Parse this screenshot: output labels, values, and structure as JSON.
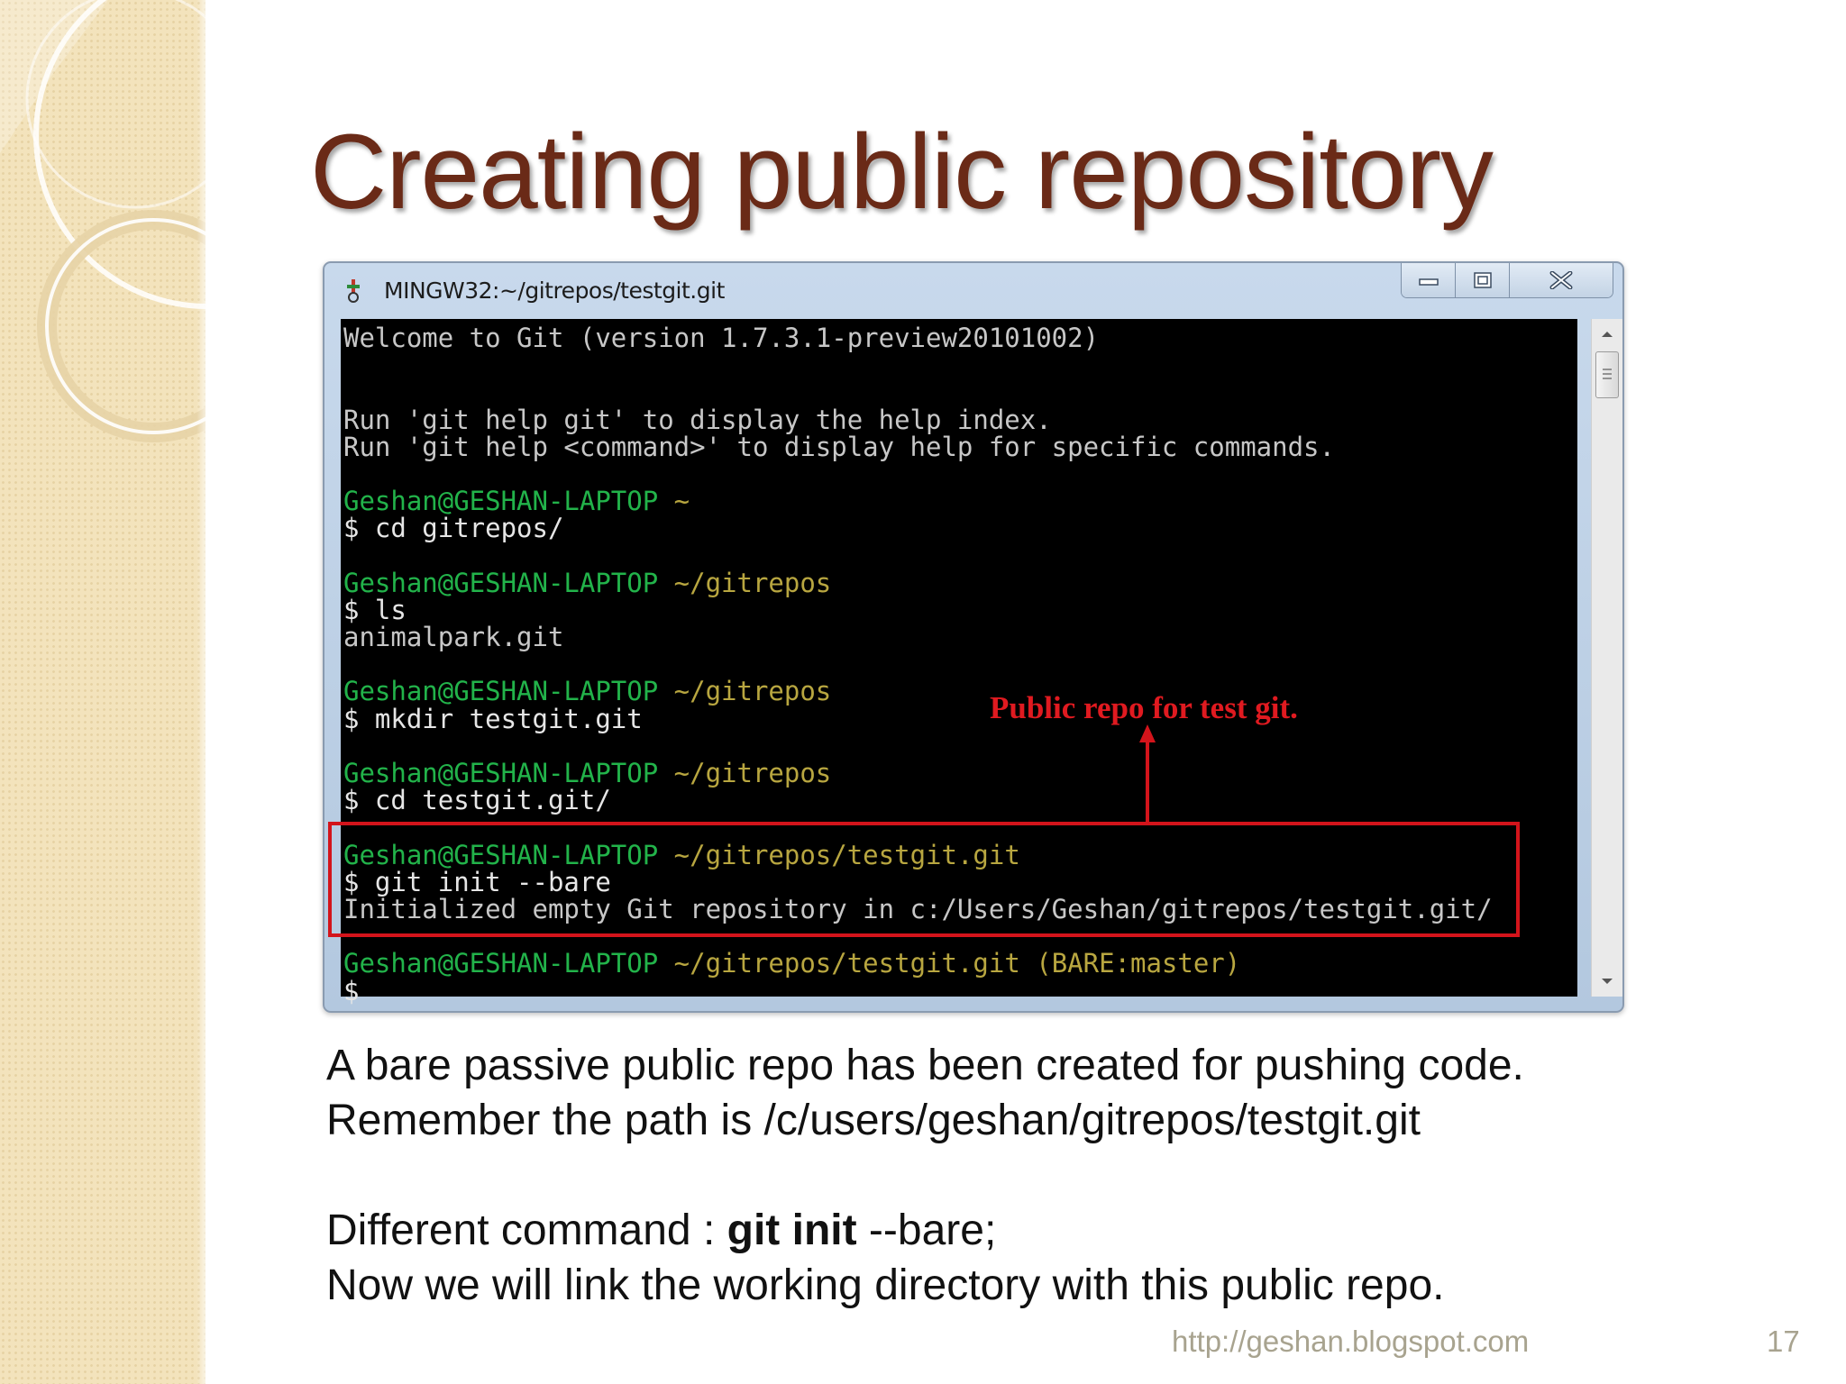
{
  "slide": {
    "title": "Creating public repository",
    "footer_url": "http://geshan.blogspot.com",
    "page_number": "17"
  },
  "window": {
    "title": "MINGW32:~/gitrepos/testgit.git",
    "icon": "git-bash-icon",
    "controls": [
      "minimize-icon",
      "maximize-icon",
      "close-icon"
    ]
  },
  "terminal": {
    "lines": [
      {
        "type": "text",
        "text": "Welcome to Git (version 1.7.3.1-preview20101002)"
      },
      {
        "type": "blank"
      },
      {
        "type": "blank"
      },
      {
        "type": "text",
        "text": "Run 'git help git' to display the help index."
      },
      {
        "type": "text",
        "text": "Run 'git help <command>' to display help for specific commands."
      },
      {
        "type": "blank"
      },
      {
        "type": "prompt",
        "user": "Geshan@GESHAN-LAPTOP",
        "path": "~"
      },
      {
        "type": "cmd",
        "text": "$ cd gitrepos/"
      },
      {
        "type": "blank"
      },
      {
        "type": "prompt",
        "user": "Geshan@GESHAN-LAPTOP",
        "path": "~/gitrepos"
      },
      {
        "type": "cmd",
        "text": "$ ls"
      },
      {
        "type": "text",
        "text": "animalpark.git"
      },
      {
        "type": "blank"
      },
      {
        "type": "prompt",
        "user": "Geshan@GESHAN-LAPTOP",
        "path": "~/gitrepos"
      },
      {
        "type": "cmd",
        "text": "$ mkdir testgit.git"
      },
      {
        "type": "blank"
      },
      {
        "type": "prompt",
        "user": "Geshan@GESHAN-LAPTOP",
        "path": "~/gitrepos"
      },
      {
        "type": "cmd",
        "text": "$ cd testgit.git/"
      },
      {
        "type": "blank"
      },
      {
        "type": "prompt",
        "user": "Geshan@GESHAN-LAPTOP",
        "path": "~/gitrepos/testgit.git"
      },
      {
        "type": "cmd",
        "text": "$ git init --bare"
      },
      {
        "type": "text",
        "text": "Initialized empty Git repository in c:/Users/Geshan/gitrepos/testgit.git/"
      },
      {
        "type": "blank"
      },
      {
        "type": "prompt",
        "user": "Geshan@GESHAN-LAPTOP",
        "path": "~/gitrepos/testgit.git (BARE:master)"
      },
      {
        "type": "cmd",
        "text": "$"
      }
    ],
    "annotation": "Public repo for test git."
  },
  "body": {
    "line1": "A bare passive public repo has been created for pushing code.",
    "line2": "Remember the path is /c/users/geshan/gitrepos/testgit.git",
    "line3_prefix": "Different command : ",
    "line3_bold": "git init",
    "line3_suffix": " --bare;",
    "line4": "Now we will link the working directory with this public repo."
  },
  "colors": {
    "title": "#6a2a17",
    "prompt_user": "#22b34a",
    "prompt_path": "#b8a640",
    "annotation": "#e01a20",
    "side_strip": "#f3e3bc"
  }
}
